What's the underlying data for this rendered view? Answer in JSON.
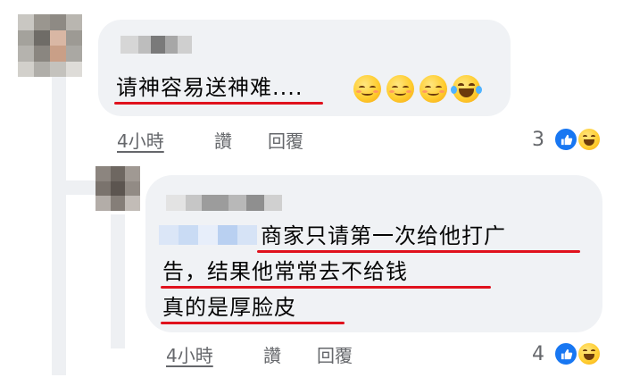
{
  "comments": [
    {
      "lines": [
        "请神容易送神难...."
      ],
      "emojis": [
        "relieved-smile-emoji",
        "relieved-smile-emoji",
        "relieved-smile-emoji",
        "laughing-tears-emoji"
      ],
      "time": "4小時",
      "like_label": "讚",
      "reply_label": "回覆",
      "reaction_count": "3",
      "reactions": [
        "like-icon",
        "haha-icon"
      ]
    },
    {
      "lines": [
        "商家只请第一次给他打广",
        "告，结果他常常去不给钱",
        "真的是厚脸皮"
      ],
      "time": "4小時",
      "like_label": "讚",
      "reply_label": "回覆",
      "reaction_count": "4",
      "reactions": [
        "like-icon",
        "haha-icon"
      ]
    }
  ],
  "colors": {
    "bubble": "#f0f2f5",
    "underline": "#e0121d",
    "like_blue": "#1877f2",
    "meta_text": "#65676b"
  }
}
